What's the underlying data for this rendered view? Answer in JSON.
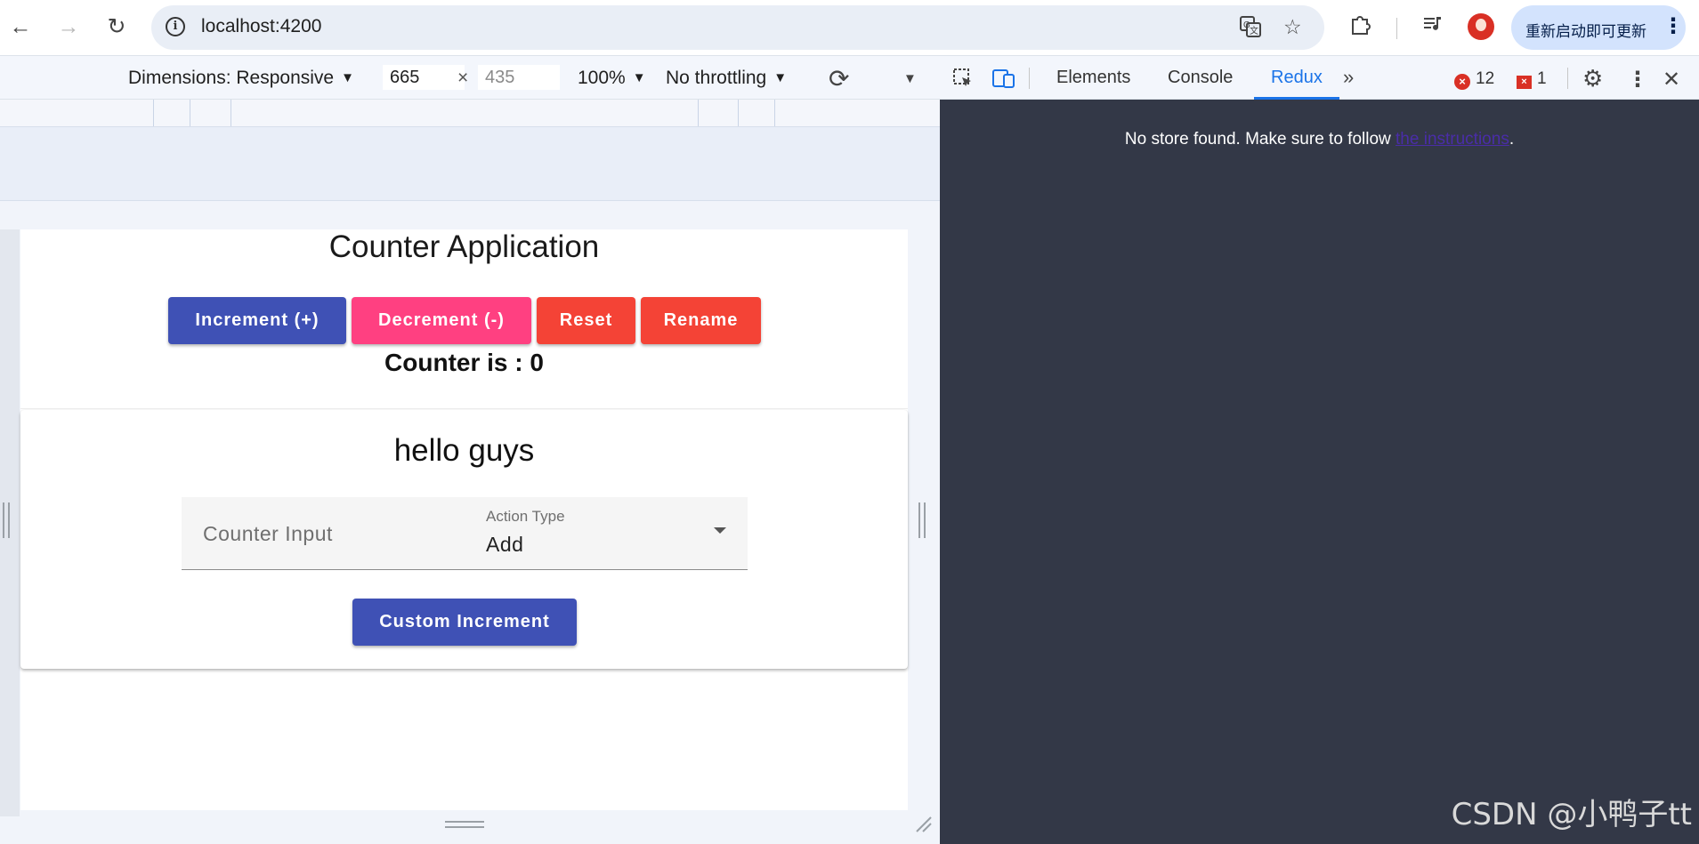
{
  "browser": {
    "url": "localhost:4200",
    "update_button_label": "重新启动即可更新",
    "back_icon": "←",
    "forward_icon": "→",
    "reload_icon": "↻"
  },
  "device_toolbar": {
    "dimensions_label": "Dimensions: Responsive",
    "width_value": "665",
    "times": "×",
    "height_value": "435",
    "zoom_label": "100%",
    "throttling_label": "No throttling"
  },
  "devtools": {
    "tabs": [
      "Elements",
      "Console",
      "Redux"
    ],
    "active_tab": "Redux",
    "error_count": "12",
    "issue_count": "1",
    "message_prefix": "No store found. Make sure to follow ",
    "message_link": "the instructions",
    "message_suffix": "."
  },
  "app": {
    "title": "Counter Application",
    "buttons": [
      {
        "label": "Increment (+)",
        "color": "#3f51b5"
      },
      {
        "label": "Decrement (-)",
        "color": "#ff4081"
      },
      {
        "label": "Reset",
        "color": "#f44336"
      },
      {
        "label": "Rename",
        "color": "#f44336"
      }
    ],
    "counter_label": "Counter is : ",
    "counter_value": "0",
    "greeting": "hello guys",
    "counter_input_placeholder": "Counter Input",
    "action_type_label": "Action Type",
    "action_type_value": "Add",
    "custom_increment_label": "Custom Increment"
  },
  "watermark": "CSDN @小鸭子tt"
}
